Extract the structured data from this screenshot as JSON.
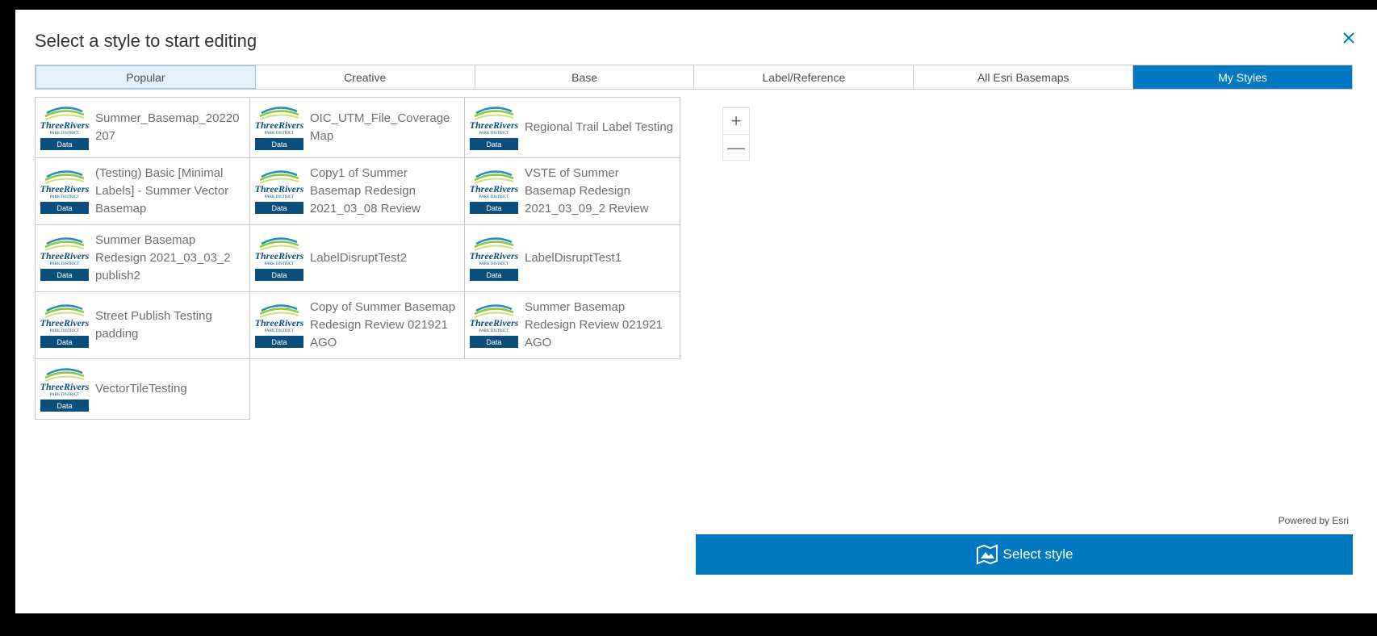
{
  "dialog": {
    "title": "Select a style to start editing",
    "close_icon": "close-icon"
  },
  "tabs": [
    {
      "label": "Popular",
      "state": "hover"
    },
    {
      "label": "Creative",
      "state": "normal"
    },
    {
      "label": "Base",
      "state": "normal"
    },
    {
      "label": "Label/Reference",
      "state": "normal"
    },
    {
      "label": "All Esri Basemaps",
      "state": "normal"
    },
    {
      "label": "My Styles",
      "state": "selected"
    }
  ],
  "thumbnail": {
    "logo_text": "ThreeRivers",
    "logo_subtext": "PARK DISTRICT",
    "band_text": "Data"
  },
  "styles": [
    "Summer_Basemap_20220207",
    "OIC_UTM_File_Coverage Map",
    "Regional Trail Label Testing",
    "(Testing) Basic [Minimal Labels] - Summer Vector Basemap",
    "Copy1 of Summer Basemap Redesign 2021_03_08 Review",
    "VSTE of Summer Basemap Redesign 2021_03_09_2 Review",
    "Summer Basemap Redesign 2021_03_03_2 publish2",
    "LabelDisruptTest2",
    "LabelDisruptTest1",
    "Street Publish Testing padding",
    "Copy of Summer Basemap Redesign Review 021921 AGO",
    "Summer Basemap Redesign Review 021921 AGO",
    "VectorTileTesting"
  ],
  "zoom": {
    "in_label": "+",
    "out_label": "—"
  },
  "footer": {
    "powered_by": "Powered by Esri",
    "select_label": "Select style"
  },
  "colors": {
    "accent": "#0079c1",
    "tab_hover": "#e2f1fb",
    "thumb_band": "#0a4f7b"
  }
}
